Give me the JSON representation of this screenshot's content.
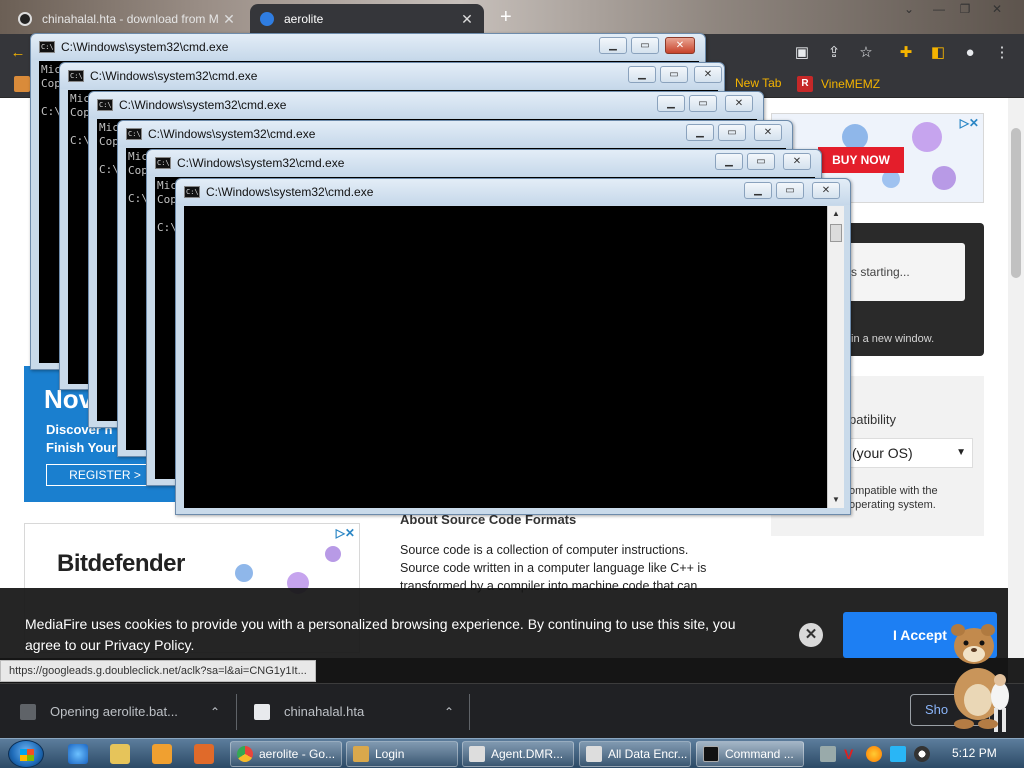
{
  "browser": {
    "tabs": [
      {
        "title": "chinahalal.hta - download from M",
        "active": false
      },
      {
        "title": "aerolite",
        "active": true
      }
    ],
    "close_glyph": "✕",
    "new_tab_glyph": "+",
    "bookmarks": [
      {
        "label": "New Tab",
        "icon": "chrome-icon"
      },
      {
        "label": "VineMEMZ",
        "icon": "vine-r-icon"
      }
    ],
    "status_url": "https://googleads.g.doubleclick.net/aclk?sa=l&ai=CNG1y1It..."
  },
  "page": {
    "ad_top_right": {
      "cta": "BUY NOW"
    },
    "right_card": {
      "status": "s starting...",
      "hint": "in a new window."
    },
    "compat": {
      "label": "patibility",
      "select_value": "(your OS)",
      "note": "ompatible with the operating system."
    },
    "promo": {
      "big": "Nov",
      "line1": "Discover n",
      "line2": "Finish Your",
      "register": "REGISTER >"
    },
    "about_title": "About Source Code Formats",
    "about_text": "Source code is a collection of computer instructions. Source code written in a computer language like C++ is transformed by a compiler into machine code that can",
    "bitdefender": {
      "brand": "Bitdefender"
    },
    "cookie": {
      "message": "MediaFire uses cookies to provide you with a personalized browsing experience. By continuing to use this site, you agree to our Privacy Policy.",
      "close": "✕",
      "accept": "I Accept"
    }
  },
  "cmd_windows": [
    {
      "title": "C:\\Windows\\system32\\cmd.exe",
      "text": "Mic\nCop\n\nC:\\"
    },
    {
      "title": "C:\\Windows\\system32\\cmd.exe",
      "text": "Mic\nCop\n\nC:\\"
    },
    {
      "title": "C:\\Windows\\system32\\cmd.exe",
      "text": "Mic\nCop\n\nC:\\"
    },
    {
      "title": "C:\\Windows\\system32\\cmd.exe",
      "text": "Mic\nCop\n\nC:\\"
    },
    {
      "title": "C:\\Windows\\system32\\cmd.exe",
      "text": "Mic\nCop\n\nC:\\"
    },
    {
      "title": "C:\\Windows\\system32\\cmd.exe",
      "text": ""
    }
  ],
  "cmd_buttons": {
    "minimize": "▁",
    "maximize": "▭",
    "close": "✕"
  },
  "downloads": [
    {
      "label": "Opening aerolite.bat..."
    },
    {
      "label": "chinahalal.hta"
    }
  ],
  "downloads_show_all": "Sho",
  "taskbar": {
    "buttons": [
      {
        "label": "aerolite - Go...",
        "icon": "chrome-icon",
        "color": "#e8453c"
      },
      {
        "label": "Login",
        "icon": "app-icon",
        "color": "#d9a84c"
      },
      {
        "label": "Agent.DMR...",
        "icon": "window-icon",
        "color": "#dddddd"
      },
      {
        "label": "All Data Encr...",
        "icon": "window-icon",
        "color": "#dddddd"
      },
      {
        "label": "Command ...",
        "icon": "cmd-icon",
        "color": "#111111"
      }
    ],
    "clock": "5:12 PM"
  }
}
